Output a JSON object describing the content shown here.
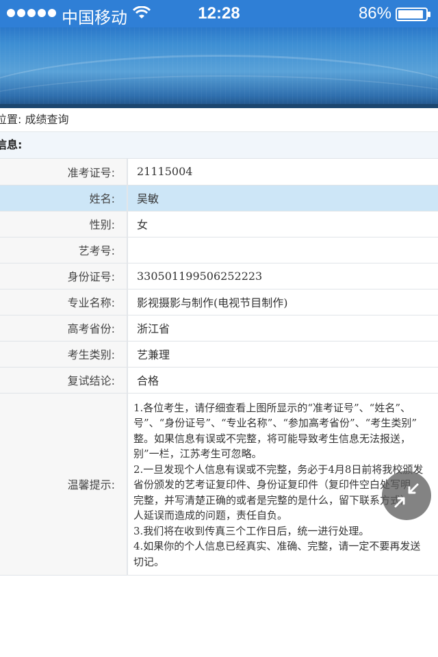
{
  "status_bar": {
    "carrier": "中国移动",
    "time": "12:28",
    "battery": "86%"
  },
  "breadcrumb": {
    "text": "位置: 成绩查询"
  },
  "section_header": {
    "text": "信息:"
  },
  "fields": [
    {
      "label": "准考证号:",
      "value": "21115004"
    },
    {
      "label": "姓名:",
      "value": "吴敏"
    },
    {
      "label": "性别:",
      "value": "女"
    },
    {
      "label": "艺考号:",
      "value": ""
    },
    {
      "label": "身份证号:",
      "value": "330501199506252223"
    },
    {
      "label": "专业名称:",
      "value": "影视摄影与制作(电视节目制作)"
    },
    {
      "label": "高考省份:",
      "value": "浙江省"
    },
    {
      "label": "考生类别:",
      "value": "艺兼理"
    },
    {
      "label": "复试结论:",
      "value": "合格"
    }
  ],
  "tips": {
    "label": "温馨提示:",
    "lines": [
      "1.各位考生，请仔细查看上图所显示的“准考证号”、“姓名”、",
      "号”、“身份证号”、“专业名称”、“参加高考省份”、“考生类别”",
      "整。如果信息有误或不完整，将可能导致考生信息无法报送，",
      "别”一栏，江苏考生可忽略。",
      "2.一旦发现个人信息有误或不完整，务必于4月8日前将我校颁发",
      "省份颁发的艺考证复印件、身份证复印件（复印件空白处写明",
      "完整，并写清楚正确的或者是完整的是什么，留下联系方式）",
      "人延误而造成的问题，责任自负。",
      "3.我们将在收到传真三个工作日后，统一进行处理。",
      "4.如果你的个人信息已经真实、准确、完整，请一定不要再发送",
      "切记。"
    ]
  },
  "icons": {
    "signal": "signal-dots-icon",
    "wifi": "wifi-icon",
    "battery": "battery-icon",
    "collapse": "collapse-arrows-icon"
  },
  "colors": {
    "status_bar": "#2f7fd6",
    "highlight_row": "#cde6f7",
    "label_bg": "#f7f7f7"
  }
}
